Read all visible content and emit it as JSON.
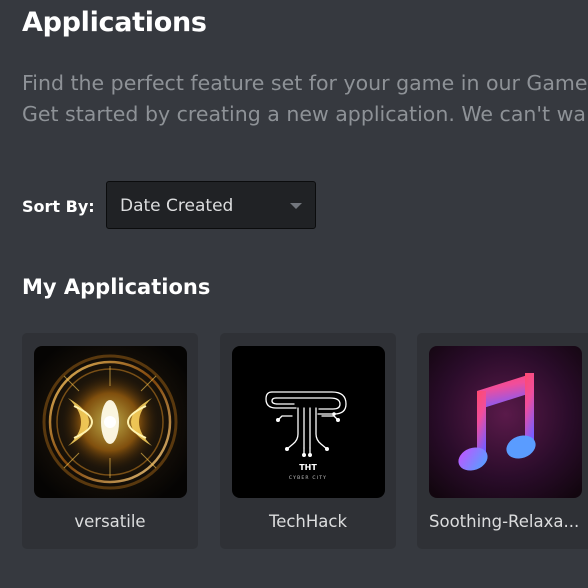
{
  "header": {
    "title": "Applications",
    "description_lines": [
      "Find the perfect feature set for your game in our Game",
      "Get started by creating a new application. We can't wa"
    ]
  },
  "sort": {
    "label": "Sort By:",
    "selected": "Date Created",
    "caret_icon": "chevron-down-icon"
  },
  "my_applications": {
    "title": "My Applications",
    "items": [
      {
        "name": "versatile",
        "icon": "energy-orb-icon"
      },
      {
        "name": "TechHack",
        "icon": "circuit-t-logo-icon",
        "logo_text": "THT",
        "logo_subtext": "CYBER CITY"
      },
      {
        "name": "Soothing-Relaxa...",
        "icon": "music-note-icon"
      }
    ]
  },
  "colors": {
    "background": "#36393f",
    "card_background": "#2f3136",
    "select_background": "#202225",
    "muted_text": "#8e9297"
  }
}
